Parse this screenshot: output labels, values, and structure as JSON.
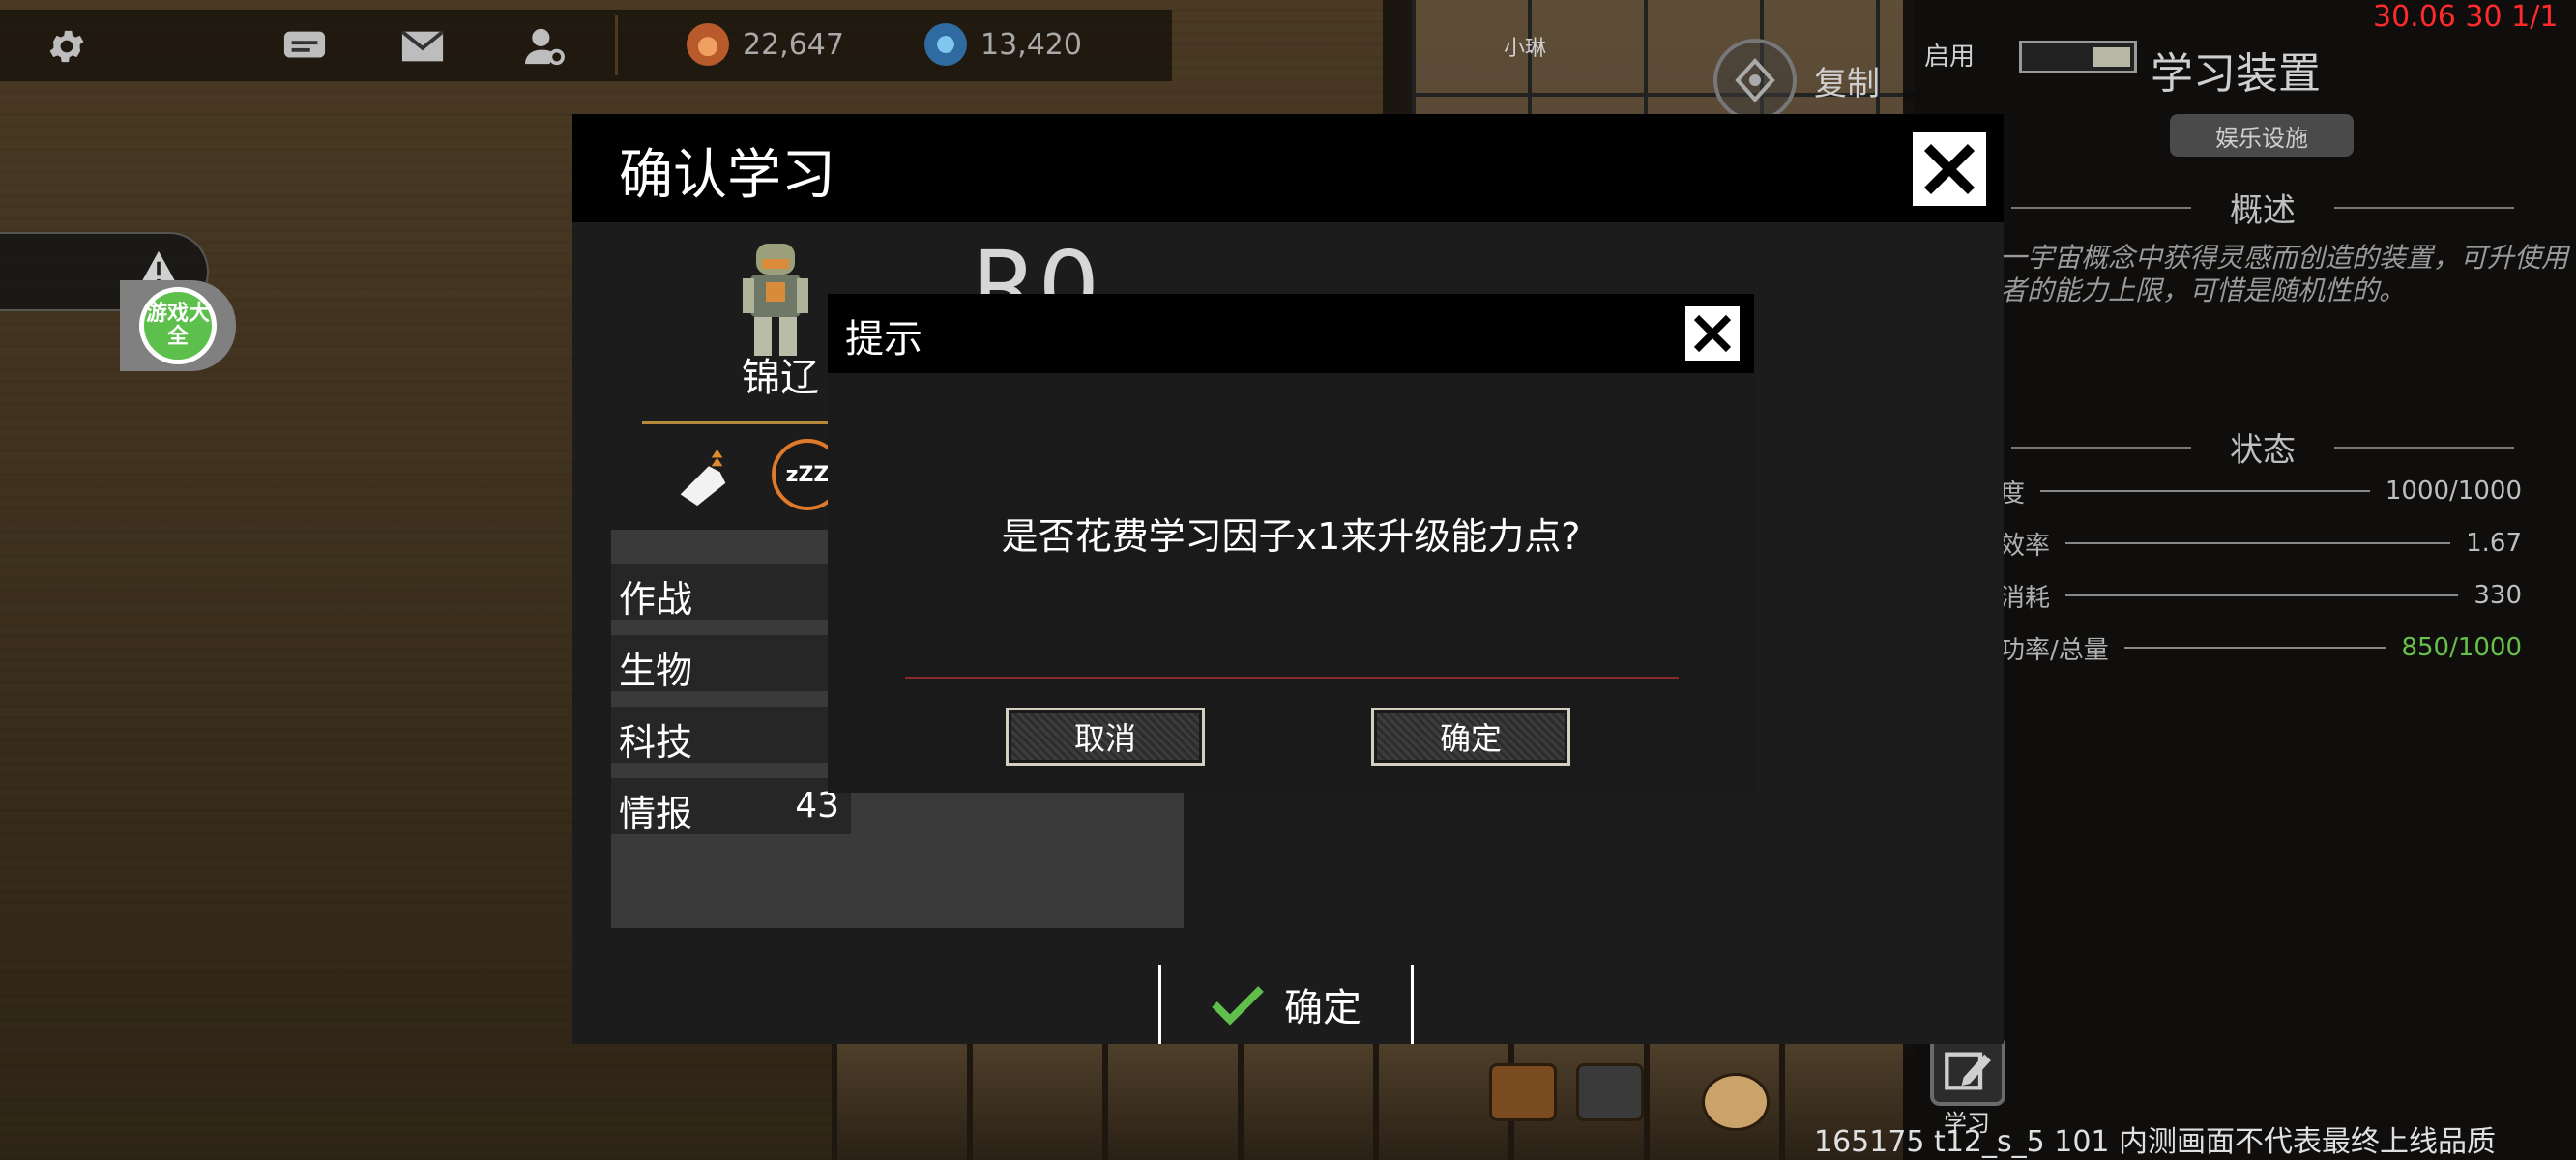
{
  "hud": {
    "resource_gold": "22,647",
    "resource_blue": "13,420"
  },
  "world": {
    "room_label": "小琳",
    "copy_label": "复制",
    "games_badge": "游戏大全"
  },
  "side_panel": {
    "enable_label": "启用",
    "title": "学习装置",
    "tag": "娱乐设施",
    "overview_heading": "概述",
    "description": "一宇宙概念中获得灵感而创造的装置，可升使用者的能力上限，可惜是随机性的。",
    "status_heading": "状态",
    "stats": [
      {
        "label": "度",
        "value": "1000/1000"
      },
      {
        "label": "效率",
        "value": "1.67"
      },
      {
        "label": "消耗",
        "value": "330"
      },
      {
        "label": "功率/总量",
        "value": "850/1000"
      }
    ]
  },
  "debug": {
    "top_right": "30.06 30 1/1",
    "footer": "165175 t12_s_5 101  内测画面不代表最终上线品质",
    "learn_label": "学习"
  },
  "main_dialog": {
    "title": "确认学习",
    "character_name": "锦辽",
    "big_code": "R0",
    "sleep_icon_text": "zZZ",
    "attributes": [
      {
        "label": "作战",
        "value": ""
      },
      {
        "label": "生物",
        "value": ""
      },
      {
        "label": "科技",
        "value": ""
      },
      {
        "label": "情报",
        "value": "43"
      }
    ],
    "confirm_label": "确定"
  },
  "hint_dialog": {
    "title": "提示",
    "message": "是否花费学习因子x1来升级能力点?",
    "cancel_label": "取消",
    "ok_label": "确定"
  },
  "colors": {
    "debug_red": "#ff2b2b",
    "power_green": "#67c04a",
    "check_green": "#5fbf4a"
  }
}
